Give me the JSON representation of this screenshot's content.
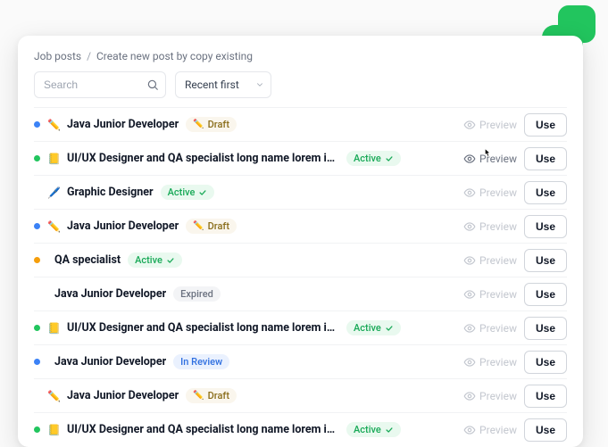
{
  "breadcrumb": {
    "root": "Job posts",
    "current": "Create new post by copy existing"
  },
  "search": {
    "placeholder": "Search"
  },
  "sort": {
    "selected": "Recent first"
  },
  "actions": {
    "preview": "Preview",
    "use": "Use"
  },
  "badge_labels": {
    "draft": "Draft",
    "active": "Active",
    "expired": "Expired",
    "review": "In Review"
  },
  "rows": [
    {
      "dot": "blue",
      "emoji": "✏️",
      "title": "Java Junior Developer",
      "badge": "draft",
      "hover": false
    },
    {
      "dot": "green",
      "emoji": "📒",
      "title": "UI/UX Designer and QA specialist long name lorem ip...",
      "badge": "active",
      "hover": true
    },
    {
      "dot": "none",
      "emoji": "🖊️",
      "title": "Graphic Designer",
      "badge": "active",
      "hover": false
    },
    {
      "dot": "blue",
      "emoji": "✏️",
      "title": "Java Junior Developer",
      "badge": "draft",
      "hover": false
    },
    {
      "dot": "orange",
      "emoji": "",
      "title": "QA specialist",
      "badge": "active",
      "hover": false
    },
    {
      "dot": "none",
      "emoji": "",
      "title": "Java Junior Developer",
      "badge": "expired",
      "hover": false
    },
    {
      "dot": "green",
      "emoji": "📒",
      "title": "UI/UX Designer and QA specialist long name lorem ip...",
      "badge": "active",
      "hover": false
    },
    {
      "dot": "blue",
      "emoji": "",
      "title": "Java Junior Developer",
      "badge": "review",
      "hover": false
    },
    {
      "dot": "none",
      "emoji": "✏️",
      "title": "Java Junior Developer",
      "badge": "draft",
      "hover": false
    },
    {
      "dot": "green",
      "emoji": "📒",
      "title": "UI/UX Designer and QA specialist long name lorem ip...",
      "badge": "active",
      "hover": false
    }
  ]
}
